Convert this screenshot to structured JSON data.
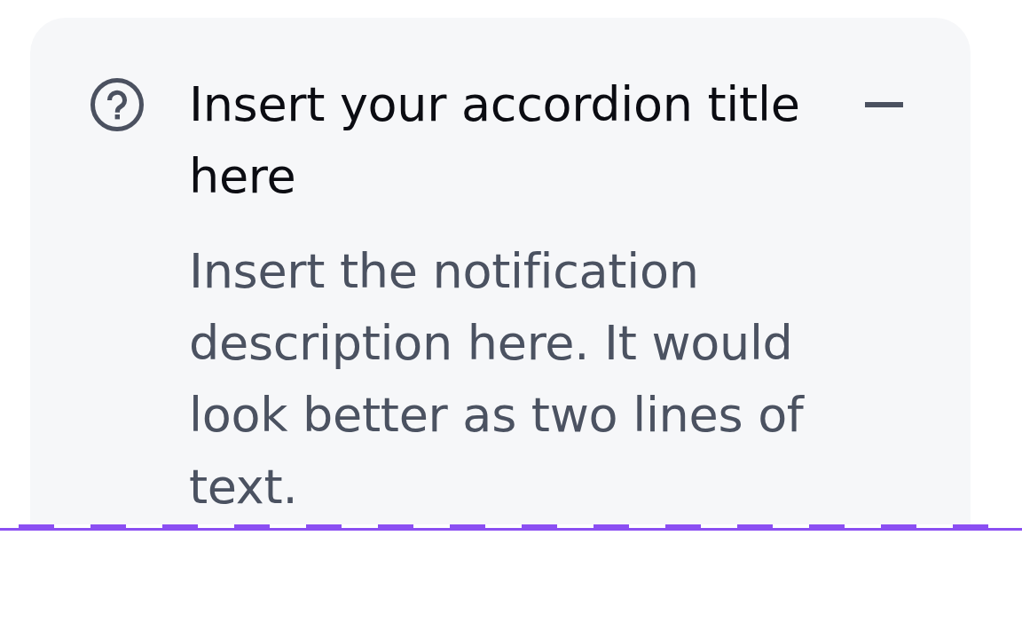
{
  "accordion": {
    "title": "Insert your accordion title here",
    "description": "Insert the notification description here. It would look better as two lines of text.",
    "expanded": true
  }
}
